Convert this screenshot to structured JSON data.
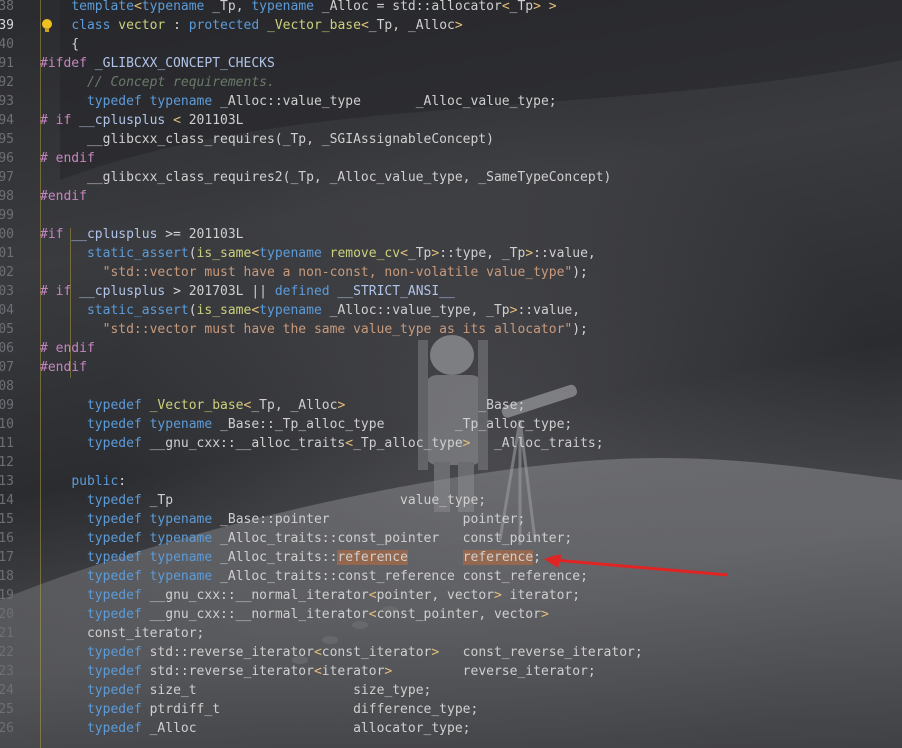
{
  "editor": {
    "active_line": "39",
    "colors": {
      "keyword": "#5c9bd8",
      "type": "#ccd07a",
      "string": "#c89a7c",
      "comment": "#6a7a6a",
      "preprocessor": "#c586c0",
      "highlight": "#be6e3c",
      "arrow": "#e02424"
    },
    "lines": [
      {
        "n": "38",
        "tokens": [
          [
            "    ",
            "t-id"
          ],
          [
            "template",
            "t-kw"
          ],
          [
            "<",
            "t-br"
          ],
          [
            "typename",
            "t-kw"
          ],
          [
            " _Tp, ",
            "t-id"
          ],
          [
            "typename",
            "t-kw"
          ],
          [
            " _Alloc = std::allocator",
            "t-id"
          ],
          [
            "<",
            "t-br"
          ],
          [
            "_Tp",
            "t-id"
          ],
          [
            "> >",
            "t-br"
          ]
        ]
      },
      {
        "n": "39",
        "tokens": [
          [
            "    ",
            "t-id"
          ],
          [
            "class",
            "t-kw"
          ],
          [
            " ",
            "t-id"
          ],
          [
            "vector",
            "t-ty"
          ],
          [
            " : ",
            "t-op"
          ],
          [
            "protected",
            "t-kw"
          ],
          [
            " ",
            "t-id"
          ],
          [
            "_Vector_base",
            "t-ty"
          ],
          [
            "<",
            "t-br"
          ],
          [
            "_Tp, _Alloc",
            "t-id"
          ],
          [
            ">",
            "t-br"
          ]
        ]
      },
      {
        "n": "40",
        "tokens": [
          [
            "    {",
            "t-op"
          ]
        ]
      },
      {
        "n": "91",
        "tokens": [
          [
            "#ifdef",
            "t-pp"
          ],
          [
            " _GLIBCXX_CONCEPT_CHECKS",
            "t-mac"
          ]
        ]
      },
      {
        "n": "92",
        "tokens": [
          [
            "      ",
            "t-id"
          ],
          [
            "// Concept requirements.",
            "t-cm"
          ]
        ]
      },
      {
        "n": "93",
        "tokens": [
          [
            "      ",
            "t-id"
          ],
          [
            "typedef",
            "t-kw"
          ],
          [
            " ",
            "t-id"
          ],
          [
            "typename",
            "t-kw"
          ],
          [
            " _Alloc::value_type       _Alloc_value_type;",
            "t-id"
          ]
        ]
      },
      {
        "n": "94",
        "tokens": [
          [
            "# if",
            "t-pp"
          ],
          [
            " __cplusplus ",
            "t-mac"
          ],
          [
            "<",
            "t-br"
          ],
          [
            " 201103L",
            "t-id"
          ]
        ]
      },
      {
        "n": "95",
        "tokens": [
          [
            "      __glibcxx_class_requires(_Tp, _SGIAssignableConcept)",
            "t-id"
          ]
        ]
      },
      {
        "n": "96",
        "tokens": [
          [
            "# endif",
            "t-pp"
          ]
        ]
      },
      {
        "n": "97",
        "tokens": [
          [
            "      __glibcxx_class_requires2(_Tp, _Alloc_value_type, _SameTypeConcept)",
            "t-id"
          ]
        ]
      },
      {
        "n": "98",
        "tokens": [
          [
            "#endif",
            "t-pp"
          ]
        ]
      },
      {
        "n": "99",
        "tokens": [
          [
            "",
            "t-id"
          ]
        ]
      },
      {
        "n": "00",
        "tokens": [
          [
            "#if",
            "t-pp"
          ],
          [
            " __cplusplus ",
            "t-mac"
          ],
          [
            ">=",
            "t-op"
          ],
          [
            " 201103L",
            "t-id"
          ]
        ]
      },
      {
        "n": "01",
        "tokens": [
          [
            "      ",
            "t-id"
          ],
          [
            "static_assert",
            "t-kw"
          ],
          [
            "(",
            "t-op"
          ],
          [
            "is_same",
            "t-ty"
          ],
          [
            "<",
            "t-br"
          ],
          [
            "typename",
            "t-kw"
          ],
          [
            " ",
            "t-id"
          ],
          [
            "remove_cv",
            "t-ty"
          ],
          [
            "<",
            "t-br"
          ],
          [
            "_Tp",
            "t-id"
          ],
          [
            ">",
            "t-br"
          ],
          [
            "::type, _Tp",
            "t-id"
          ],
          [
            ">",
            "t-br"
          ],
          [
            "::value,",
            "t-id"
          ]
        ]
      },
      {
        "n": "02",
        "tokens": [
          [
            "        ",
            "t-id"
          ],
          [
            "\"std::vector must have a non-const, non-volatile value_type\"",
            "t-str"
          ],
          [
            ");",
            "t-op"
          ]
        ]
      },
      {
        "n": "03",
        "tokens": [
          [
            "# if",
            "t-pp"
          ],
          [
            " __cplusplus ",
            "t-mac"
          ],
          [
            ">",
            "t-op"
          ],
          [
            " 201703L || ",
            "t-id"
          ],
          [
            "defined",
            "t-kw"
          ],
          [
            " __STRICT_ANSI__",
            "t-mac"
          ]
        ]
      },
      {
        "n": "04",
        "tokens": [
          [
            "      ",
            "t-id"
          ],
          [
            "static_assert",
            "t-kw"
          ],
          [
            "(",
            "t-op"
          ],
          [
            "is_same",
            "t-ty"
          ],
          [
            "<",
            "t-br"
          ],
          [
            "typename",
            "t-kw"
          ],
          [
            " _Alloc::value_type, _Tp",
            "t-id"
          ],
          [
            ">",
            "t-br"
          ],
          [
            "::value,",
            "t-id"
          ]
        ]
      },
      {
        "n": "05",
        "tokens": [
          [
            "        ",
            "t-id"
          ],
          [
            "\"std::vector must have the same value_type as its allocator\"",
            "t-str"
          ],
          [
            ");",
            "t-op"
          ]
        ]
      },
      {
        "n": "06",
        "tokens": [
          [
            "# endif",
            "t-pp"
          ]
        ]
      },
      {
        "n": "07",
        "tokens": [
          [
            "#endif",
            "t-pp"
          ]
        ]
      },
      {
        "n": "08",
        "tokens": [
          [
            "",
            "t-id"
          ]
        ]
      },
      {
        "n": "09",
        "tokens": [
          [
            "      ",
            "t-id"
          ],
          [
            "typedef",
            "t-kw"
          ],
          [
            " ",
            "t-id"
          ],
          [
            "_Vector_base",
            "t-ty"
          ],
          [
            "<",
            "t-br"
          ],
          [
            "_Tp, _Alloc",
            "t-id"
          ],
          [
            ">",
            "t-br"
          ],
          [
            "                 _Base;",
            "t-id"
          ]
        ]
      },
      {
        "n": "10",
        "tokens": [
          [
            "      ",
            "t-id"
          ],
          [
            "typedef",
            "t-kw"
          ],
          [
            " ",
            "t-id"
          ],
          [
            "typename",
            "t-kw"
          ],
          [
            " _Base::_Tp_alloc_type         _Tp_alloc_type;",
            "t-id"
          ]
        ]
      },
      {
        "n": "11",
        "tokens": [
          [
            "      ",
            "t-id"
          ],
          [
            "typedef",
            "t-kw"
          ],
          [
            " __gnu_cxx::__alloc_traits",
            "t-id"
          ],
          [
            "<",
            "t-br"
          ],
          [
            "_Tp_alloc_type",
            "t-id"
          ],
          [
            ">",
            "t-br"
          ],
          [
            "   _Alloc_traits;",
            "t-id"
          ]
        ]
      },
      {
        "n": "12",
        "tokens": [
          [
            "",
            "t-id"
          ]
        ]
      },
      {
        "n": "13",
        "tokens": [
          [
            "    ",
            "t-id"
          ],
          [
            "public",
            "t-kw"
          ],
          [
            ":",
            "t-op"
          ]
        ]
      },
      {
        "n": "14",
        "tokens": [
          [
            "      ",
            "t-id"
          ],
          [
            "typedef",
            "t-kw"
          ],
          [
            " _Tp                             value_type;",
            "t-id"
          ]
        ]
      },
      {
        "n": "15",
        "tokens": [
          [
            "      ",
            "t-id"
          ],
          [
            "typedef",
            "t-kw"
          ],
          [
            " ",
            "t-id"
          ],
          [
            "typename",
            "t-kw"
          ],
          [
            " _Base::pointer                 pointer;",
            "t-id"
          ]
        ]
      },
      {
        "n": "16",
        "tokens": [
          [
            "      ",
            "t-id"
          ],
          [
            "typedef",
            "t-kw"
          ],
          [
            " ",
            "t-id"
          ],
          [
            "typename",
            "t-kw"
          ],
          [
            " _Alloc_traits::const_pointer   const_pointer;",
            "t-id"
          ]
        ]
      },
      {
        "n": "17",
        "tokens": [
          [
            "      ",
            "t-id"
          ],
          [
            "typedef",
            "t-kw"
          ],
          [
            " ",
            "t-id"
          ],
          [
            "typename",
            "t-kw"
          ],
          [
            " _Alloc_traits::",
            "t-id"
          ],
          [
            "reference",
            "t-id hl-ref"
          ],
          [
            "       ",
            "t-id"
          ],
          [
            "reference",
            "t-id hl-ref"
          ],
          [
            ";",
            "t-op"
          ]
        ]
      },
      {
        "n": "18",
        "tokens": [
          [
            "      ",
            "t-id"
          ],
          [
            "typedef",
            "t-kw"
          ],
          [
            " ",
            "t-id"
          ],
          [
            "typename",
            "t-kw"
          ],
          [
            " _Alloc_traits::const_reference const_reference;",
            "t-id"
          ]
        ]
      },
      {
        "n": "19",
        "tokens": [
          [
            "      ",
            "t-id"
          ],
          [
            "typedef",
            "t-kw"
          ],
          [
            " __gnu_cxx::__normal_iterator",
            "t-id"
          ],
          [
            "<",
            "t-br"
          ],
          [
            "pointer, vector",
            "t-id"
          ],
          [
            ">",
            "t-br"
          ],
          [
            " iterator;",
            "t-id"
          ]
        ]
      },
      {
        "n": "20",
        "tokens": [
          [
            "      ",
            "t-id"
          ],
          [
            "typedef",
            "t-kw"
          ],
          [
            " __gnu_cxx::__normal_iterator",
            "t-id"
          ],
          [
            "<",
            "t-br"
          ],
          [
            "const_pointer, vector",
            "t-id"
          ],
          [
            ">",
            "t-br"
          ]
        ]
      },
      {
        "n": "21",
        "tokens": [
          [
            "      const_iterator;",
            "t-id"
          ]
        ]
      },
      {
        "n": "22",
        "tokens": [
          [
            "      ",
            "t-id"
          ],
          [
            "typedef",
            "t-kw"
          ],
          [
            " std::reverse_iterator",
            "t-id"
          ],
          [
            "<",
            "t-br"
          ],
          [
            "const_iterator",
            "t-id"
          ],
          [
            ">",
            "t-br"
          ],
          [
            "   const_reverse_iterator;",
            "t-id"
          ]
        ]
      },
      {
        "n": "23",
        "tokens": [
          [
            "      ",
            "t-id"
          ],
          [
            "typedef",
            "t-kw"
          ],
          [
            " std::reverse_iterator",
            "t-id"
          ],
          [
            "<",
            "t-br"
          ],
          [
            "iterator",
            "t-id"
          ],
          [
            ">",
            "t-br"
          ],
          [
            "         reverse_iterator;",
            "t-id"
          ]
        ]
      },
      {
        "n": "24",
        "tokens": [
          [
            "      ",
            "t-id"
          ],
          [
            "typedef",
            "t-kw"
          ],
          [
            " size_t                    size_type;",
            "t-id"
          ]
        ]
      },
      {
        "n": "25",
        "tokens": [
          [
            "      ",
            "t-id"
          ],
          [
            "typedef",
            "t-kw"
          ],
          [
            " ptrdiff_t                 difference_type;",
            "t-id"
          ]
        ]
      },
      {
        "n": "26",
        "tokens": [
          [
            "      ",
            "t-id"
          ],
          [
            "typedef",
            "t-kw"
          ],
          [
            " _Alloc                    allocator_type;",
            "t-id"
          ]
        ]
      }
    ]
  }
}
